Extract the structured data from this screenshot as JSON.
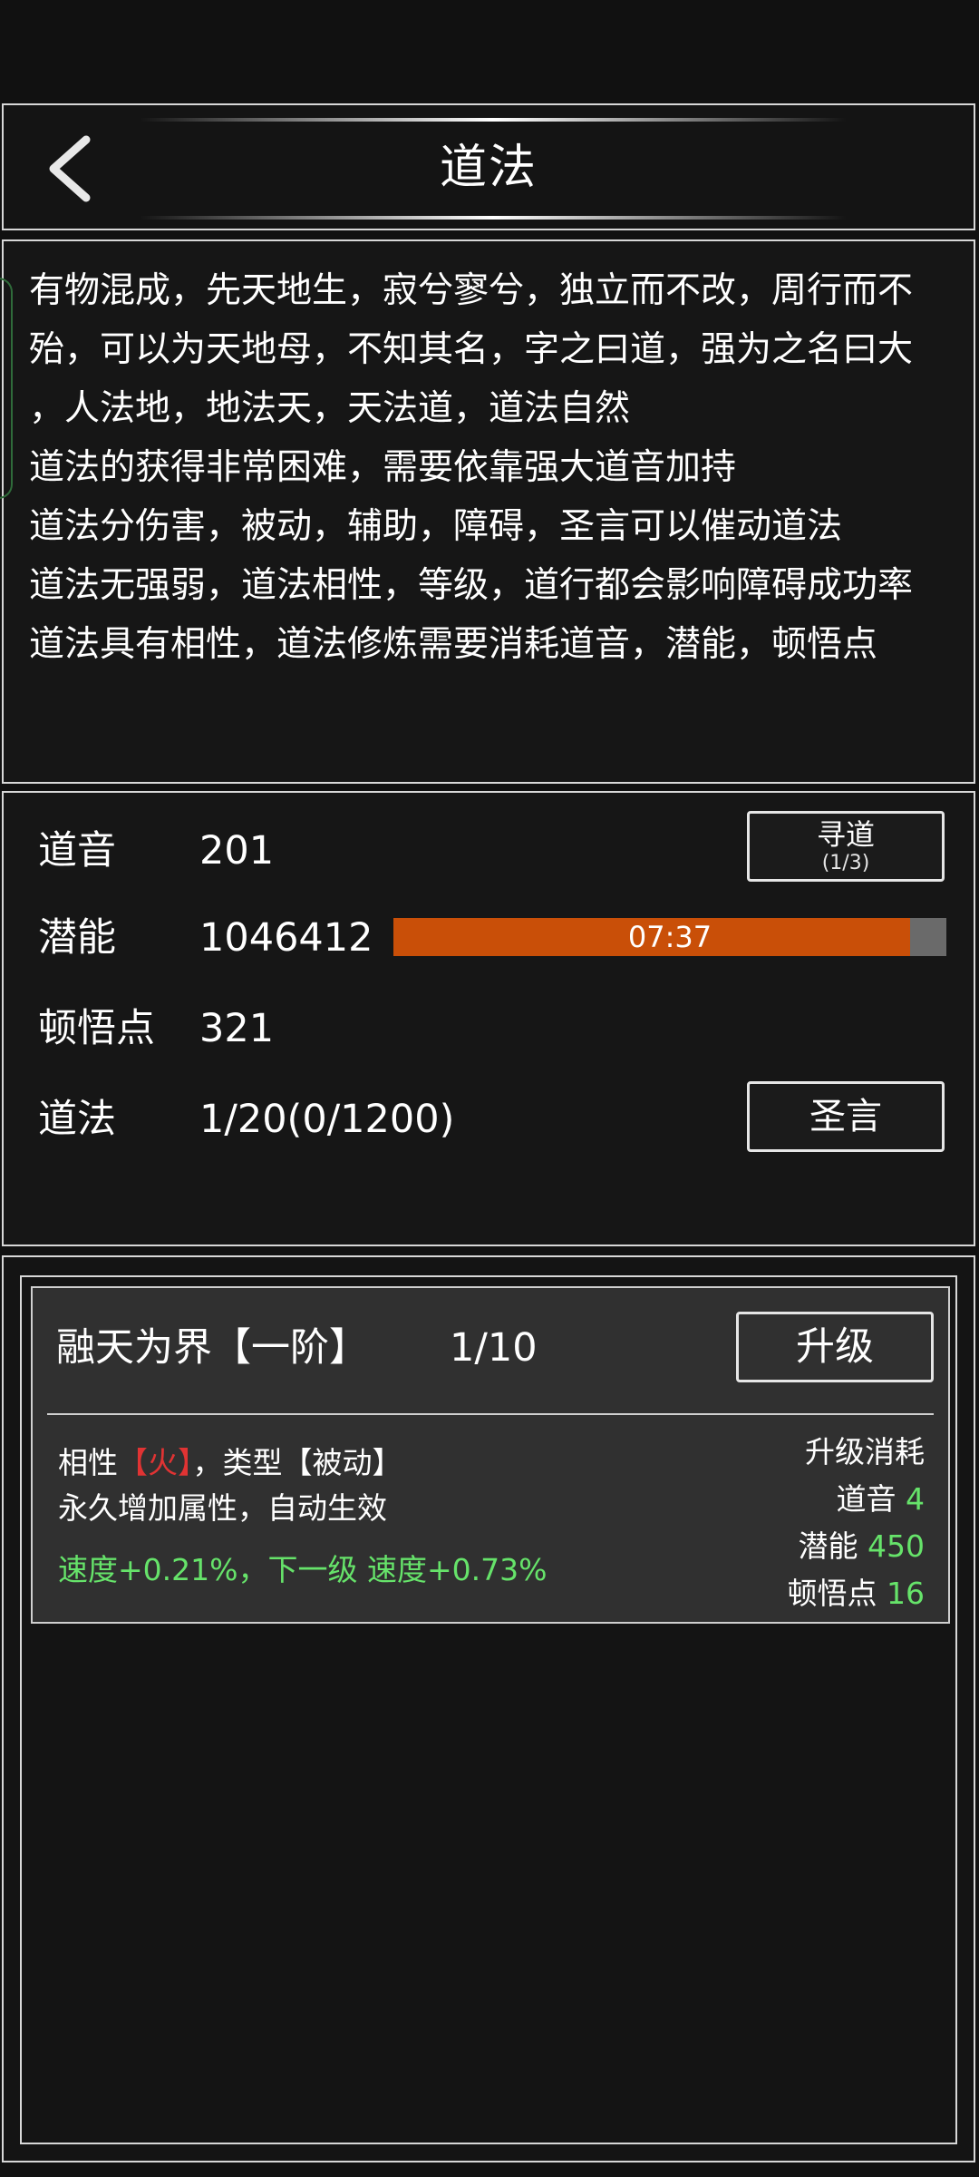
{
  "header": {
    "title": "道法"
  },
  "description": {
    "lines": [
      "有物混成，先天地生，寂兮寥兮，独立而不改，周行而不",
      "殆，可以为天地母，不知其名，字之曰道，强为之名曰大",
      "，人法地，地法天，天法道，道法自然",
      "道法的获得非常困难，需要依靠强大道音加持",
      "道法分伤害，被动，辅助，障碍，圣言可以催动道法",
      "道法无强弱，道法相性，等级，道行都会影响障碍成功率",
      "道法具有相性，道法修炼需要消耗道音，潜能，顿悟点"
    ]
  },
  "stats": {
    "daoyin": {
      "label": "道音",
      "value": "201"
    },
    "qianneng": {
      "label": "潜能",
      "value": "1046412"
    },
    "dunwu": {
      "label": "顿悟点",
      "value": "321"
    },
    "daofa": {
      "label": "道法",
      "value": "1/20(0/1200)"
    },
    "xundao_button": {
      "label": "寻道",
      "count": "(1/3)"
    },
    "shengyan_button": {
      "label": "圣言"
    },
    "timer": {
      "text": "07:37",
      "progress": 0.935,
      "fill_color": "#c94f08",
      "track_color": "#6a6a6a"
    }
  },
  "skill": {
    "name": "融天为界【一阶】",
    "level": "1/10",
    "upgrade_label": "升级",
    "affinity_prefix": "相性",
    "affinity_value": "【火】",
    "type_text": "，类型【被动】",
    "effect": "永久增加属性，自动生效",
    "speed_text": "速度+0.21%，下一级 速度+0.73%",
    "cost_title": "升级消耗",
    "costs": [
      {
        "label": "道音",
        "value": "4"
      },
      {
        "label": "潜能",
        "value": "450"
      },
      {
        "label": "顿悟点",
        "value": "16"
      }
    ]
  },
  "icons": {
    "back": "chevron-left-icon"
  },
  "colors": {
    "background": "#111111",
    "accent_orange": "#c94f08",
    "green": "#66e36a",
    "red": "#e03333"
  }
}
